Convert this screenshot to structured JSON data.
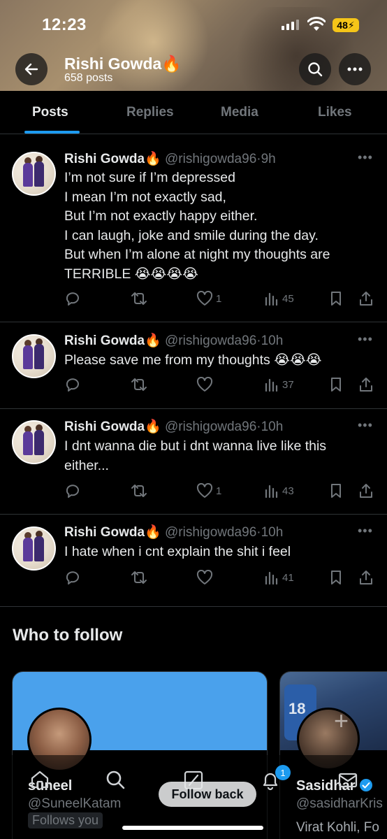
{
  "status_bar": {
    "time": "12:23",
    "battery": "48"
  },
  "header": {
    "name": "Rishi Gowda🔥",
    "post_count": "658 posts"
  },
  "tabs": [
    {
      "label": "Posts",
      "active": true
    },
    {
      "label": "Replies"
    },
    {
      "label": "Media"
    },
    {
      "label": "Likes"
    }
  ],
  "posts": [
    {
      "name": "Rishi Gowda🔥",
      "handle": "@rishigowda96",
      "time": "9h",
      "text": "I’m not sure if I’m depressed\nI mean I’m not exactly sad,\nBut I’m not exactly happy either.\nI can laugh, joke and smile during the day.\nBut when I’m alone at night my thoughts are\nTERRIBLE 😭😭😭😭",
      "likes": "1",
      "views": "45"
    },
    {
      "name": "Rishi Gowda🔥",
      "handle": "@rishigowda96",
      "time": "10h",
      "text": "Please save me from my thoughts 😭😭😭",
      "likes": "",
      "views": "37"
    },
    {
      "name": "Rishi Gowda🔥",
      "handle": "@rishigowda96",
      "time": "10h",
      "text": "I dnt wanna die but i dnt wanna live like this\neither...",
      "likes": "1",
      "views": "43"
    },
    {
      "name": "Rishi Gowda🔥",
      "handle": "@rishigowda96",
      "time": "10h",
      "text": "I hate when i cnt explain the shit i feel",
      "likes": "",
      "views": "41"
    }
  ],
  "who_to_follow": {
    "title": "Who to follow",
    "suggestions": [
      {
        "name": "suneel",
        "handle": "@SuneelKatam",
        "tag": "Follows you",
        "button": "Follow back"
      },
      {
        "name": "Sasidhar",
        "handle": "@sasidharKris",
        "bio": "Virat Kohli, Fo",
        "jersey": "18"
      }
    ]
  },
  "bottom_nav": {
    "notifications_badge": "1"
  },
  "colors": {
    "accent": "#1d9bf0",
    "background": "#000000",
    "muted": "#71767b"
  }
}
